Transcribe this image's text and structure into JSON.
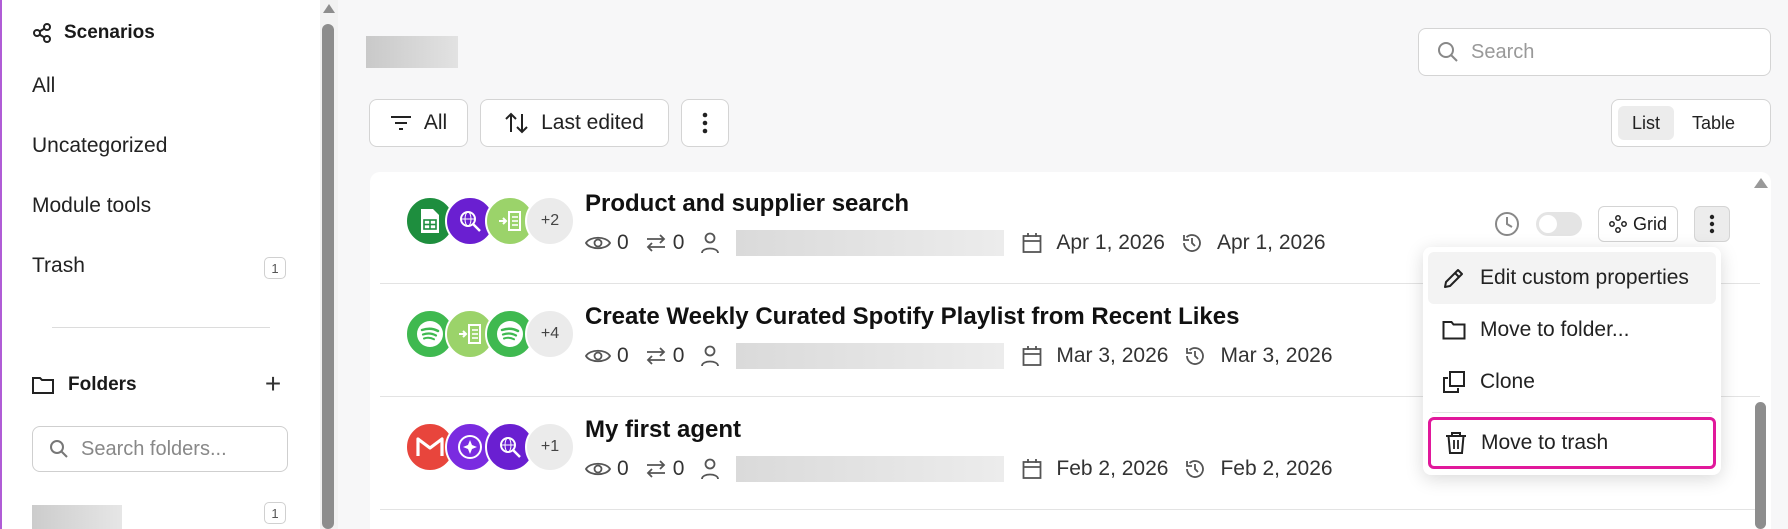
{
  "sidebar": {
    "header": "Scenarios",
    "items": [
      {
        "label": "All"
      },
      {
        "label": "Uncategorized"
      },
      {
        "label": "Module tools"
      },
      {
        "label": "Trash",
        "count": "1"
      }
    ],
    "folders_header": "Folders",
    "folder_search_placeholder": "Search folders...",
    "folder_count": "1"
  },
  "search": {
    "placeholder": "Search"
  },
  "toolbar": {
    "filter_label": "All",
    "sort_label": "Last edited",
    "view_list": "List",
    "view_table": "Table"
  },
  "scenarios": [
    {
      "title": "Product and supplier search",
      "views": "0",
      "ops": "0",
      "created": "Apr 1, 2026",
      "edited": "Apr 1, 2026",
      "more": "+2",
      "icons": [
        "google-sheets-icon",
        "web-search-icon",
        "text-parser-icon"
      ]
    },
    {
      "title": "Create Weekly Curated Spotify Playlist from Recent Likes",
      "views": "0",
      "ops": "0",
      "created": "Mar 3, 2026",
      "edited": "Mar 3, 2026",
      "more": "+4",
      "icons": [
        "spotify-icon",
        "text-parser-icon",
        "spotify-icon"
      ]
    },
    {
      "title": "My first agent",
      "views": "0",
      "ops": "0",
      "created": "Feb 2, 2026",
      "edited": "Feb 2, 2026",
      "more": "+1",
      "icons": [
        "gmail-icon",
        "ai-agent-icon",
        "web-search-icon"
      ]
    }
  ],
  "row_actions": {
    "grid_label": "Grid"
  },
  "context_menu": {
    "items": [
      {
        "label": "Edit custom properties",
        "icon": "pencil-icon"
      },
      {
        "label": "Move to folder...",
        "icon": "folder-icon"
      },
      {
        "label": "Clone",
        "icon": "copy-icon"
      },
      {
        "label": "Move to trash",
        "icon": "trash-icon"
      }
    ]
  },
  "colors": {
    "highlight": "#e1189b",
    "sheets": "#1e8e3e",
    "search_purple": "#6a1fd1",
    "parser_green": "#9bd36a",
    "spotify": "#3fb950",
    "gmail": "#e8453c"
  }
}
